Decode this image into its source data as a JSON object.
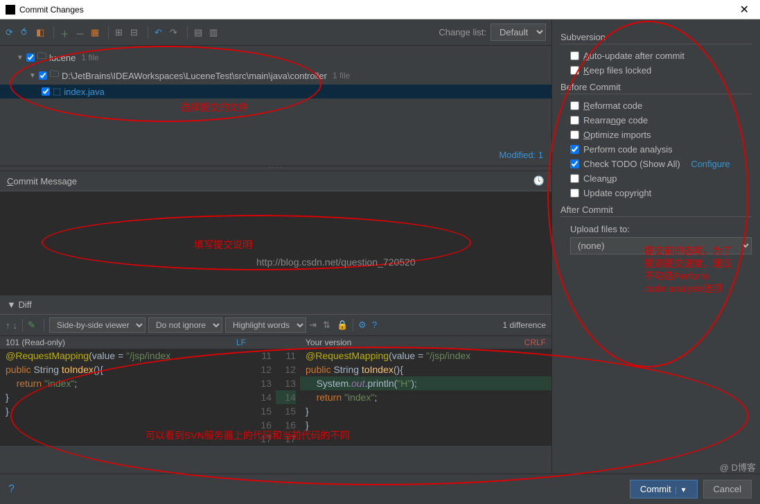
{
  "window": {
    "title": "Commit Changes"
  },
  "toolbar": {
    "changelist_label": "Change list:",
    "changelist_value": "Default"
  },
  "tree": {
    "root": {
      "label": "lucene",
      "meta": "1 file"
    },
    "folder": {
      "label": "D:\\JetBrains\\IDEAWorkspaces\\LuceneTest\\src\\main\\java\\controller",
      "meta": "1 file"
    },
    "file": {
      "label": "index.java"
    },
    "modified": "Modified: 1"
  },
  "commit_msg": {
    "header": "Commit Message"
  },
  "diff": {
    "header": "Diff",
    "viewer": "Side-by-side viewer",
    "ignore": "Do not ignore",
    "highlight": "Highlight words",
    "count": "1 difference",
    "left_header": "101 (Read-only)",
    "left_lf": "LF",
    "right_header": "Your version",
    "right_crlf": "CRLF",
    "left_lines": [
      "    @RequestMapping(value = \"/jsp/index",
      "    public String toIndex(){",
      "        return \"index\";",
      "    }",
      "}",
      ""
    ],
    "right_lines": [
      "    @RequestMapping(value = \"/jsp/index",
      "    public String toIndex(){",
      "        System.out.println(\"H\");",
      "        return \"index\";",
      "    }",
      "}"
    ],
    "gutter_left": [
      "11",
      "12",
      "13",
      "14",
      "15",
      "16",
      "17"
    ],
    "gutter_right": [
      "11",
      "12",
      "13",
      "14",
      "15",
      "16",
      "17"
    ]
  },
  "right_panel": {
    "subversion": "Subversion",
    "auto_update": "Auto-update after commit",
    "keep_locked": "Keep files locked",
    "before": "Before Commit",
    "reformat": "Reformat code",
    "rearrange": "Rearrange code",
    "optimize": "Optimize imports",
    "analysis": "Perform code analysis",
    "todo": "Check TODO (Show All)",
    "configure": "Configure",
    "cleanup": "Cleanup",
    "copyright": "Update copyright",
    "after": "After Commit",
    "upload_label": "Upload files to:",
    "upload_value": "(none)"
  },
  "footer": {
    "commit": "Commit",
    "cancel": "Cancel"
  },
  "annotations": {
    "a1": "选择提交的文件",
    "a2": "填写提交说明",
    "a3": "可以看到SVN服务器上的代码和当前代码的不同",
    "a4l1": "提交前的选项，为了",
    "a4l2": "提高提交速度，建议",
    "a4l3": "不勾选Perform",
    "a4l4": "code analysis选项"
  },
  "watermark": "http://blog.csdn.net/question_720520",
  "blog_wm": "@       D博客"
}
